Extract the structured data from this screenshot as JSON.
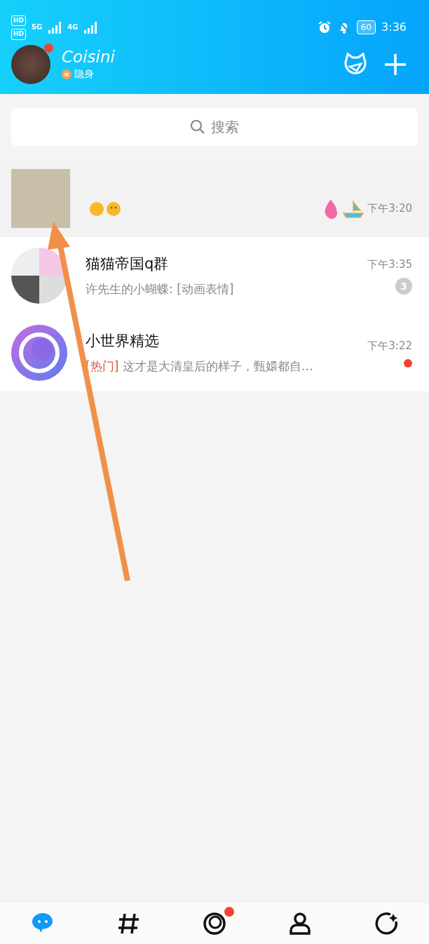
{
  "status_bar": {
    "sims": [
      "HD",
      "HD"
    ],
    "networks": [
      "5G",
      "4G"
    ],
    "battery": "60",
    "time": "3:36"
  },
  "profile": {
    "name": "Coisini",
    "status": "隐身",
    "notification_dot": true
  },
  "search": {
    "placeholder": "搜索"
  },
  "chats": [
    {
      "kind": "photo",
      "pinned": true,
      "time": "下午3:20"
    },
    {
      "kind": "group",
      "pinned": false,
      "name": "猫猫帝国q群",
      "preview": "许先生的小蝴蝶: [动画表情]",
      "time": "下午3:35",
      "unread": "3"
    },
    {
      "kind": "logo",
      "pinned": false,
      "name": "小世界精选",
      "tag": "[热门]",
      "preview": "这才是大清皇后的样子，甄嬛都自…",
      "time": "下午3:22",
      "dot": true
    }
  ],
  "tabs": [
    {
      "kind": "chat",
      "selected": true,
      "dot": false
    },
    {
      "kind": "hash",
      "selected": false,
      "dot": false
    },
    {
      "kind": "world",
      "selected": false,
      "dot": true
    },
    {
      "kind": "person",
      "selected": false,
      "dot": false
    },
    {
      "kind": "spark",
      "selected": false,
      "dot": false
    }
  ]
}
